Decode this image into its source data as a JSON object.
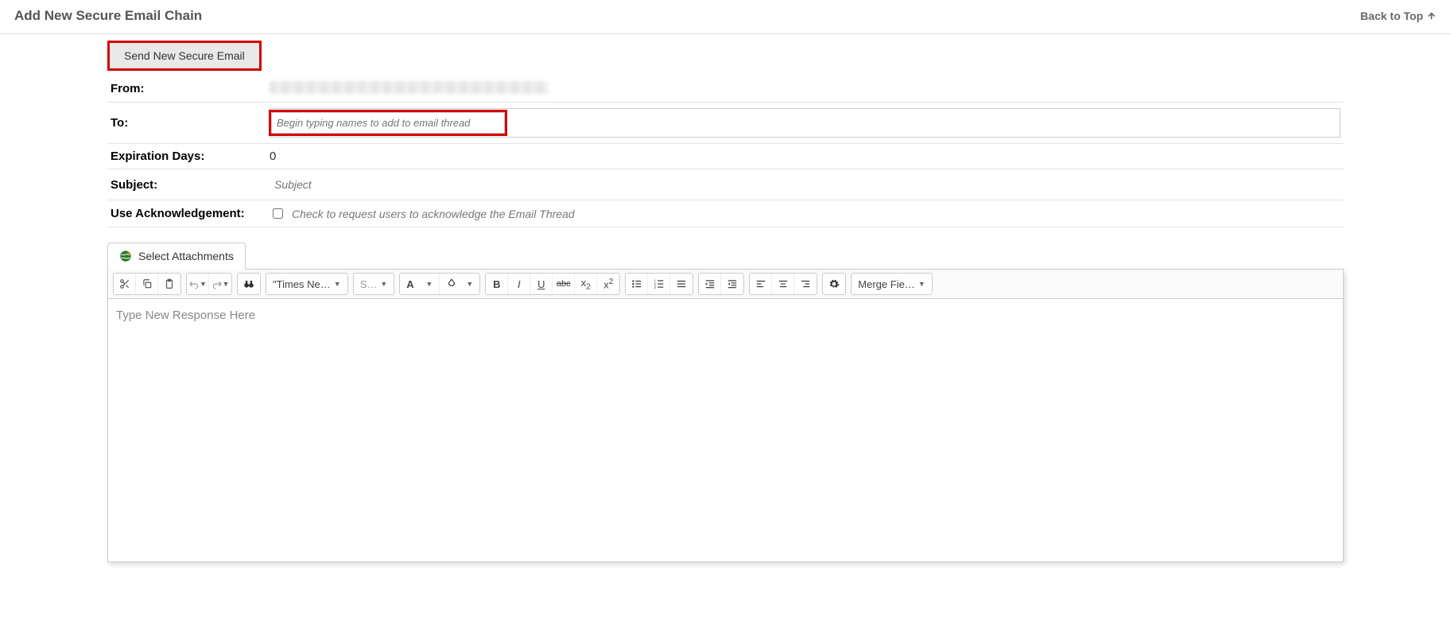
{
  "header": {
    "title": "Add New Secure Email Chain",
    "back_to_top": "Back to Top"
  },
  "form": {
    "send_button": "Send New Secure Email",
    "from_label": "From:",
    "to_label": "To:",
    "to_placeholder": "Begin typing names to add to email thread",
    "expiration_label": "Expiration Days:",
    "expiration_value": "0",
    "subject_label": "Subject:",
    "subject_placeholder": "Subject",
    "ack_label": "Use Acknowledgement:",
    "ack_text": "Check to request users to acknowledge the Email Thread"
  },
  "attachments": {
    "select_label": "Select Attachments"
  },
  "toolbar": {
    "font_family": "\"Times Ne…",
    "font_size": "S…",
    "font_btn": "A",
    "merge_fields": "Merge Fie…"
  },
  "editor": {
    "placeholder": "Type New Response Here"
  }
}
